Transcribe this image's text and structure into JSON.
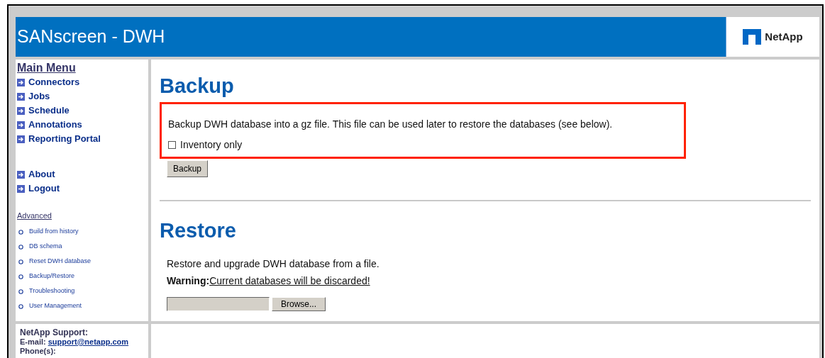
{
  "header": {
    "title": "SANscreen - DWH",
    "logo_text": "NetApp"
  },
  "sidebar": {
    "main_menu_title": "Main Menu",
    "main_items": [
      {
        "label": "Connectors"
      },
      {
        "label": "Jobs"
      },
      {
        "label": "Schedule"
      },
      {
        "label": "Annotations"
      },
      {
        "label": "Reporting Portal"
      }
    ],
    "account_items": [
      {
        "label": "About"
      },
      {
        "label": "Logout"
      }
    ],
    "advanced_title": "Advanced",
    "advanced_items": [
      {
        "label": "Build from history"
      },
      {
        "label": "DB schema"
      },
      {
        "label": "Reset DWH database"
      },
      {
        "label": "Backup/Restore"
      },
      {
        "label": "Troubleshooting"
      },
      {
        "label": "User Management"
      }
    ],
    "support": {
      "title": "NetApp Support:",
      "email_label": "E-mail:",
      "email": "support@netapp.com",
      "phone_label": "Phone(s):"
    }
  },
  "backup": {
    "heading": "Backup",
    "description": "Backup DWH database into a gz file. This file can be used later to restore the databases (see below).",
    "highlighted": true,
    "inventory_only": {
      "label": "Inventory only",
      "checked": false
    },
    "button": "Backup"
  },
  "restore": {
    "heading": "Restore",
    "description": "Restore and upgrade DWH database from a file.",
    "warning_label": "Warning:",
    "warning_text": "Current databases will be discarded!",
    "browse_button": "Browse..."
  }
}
